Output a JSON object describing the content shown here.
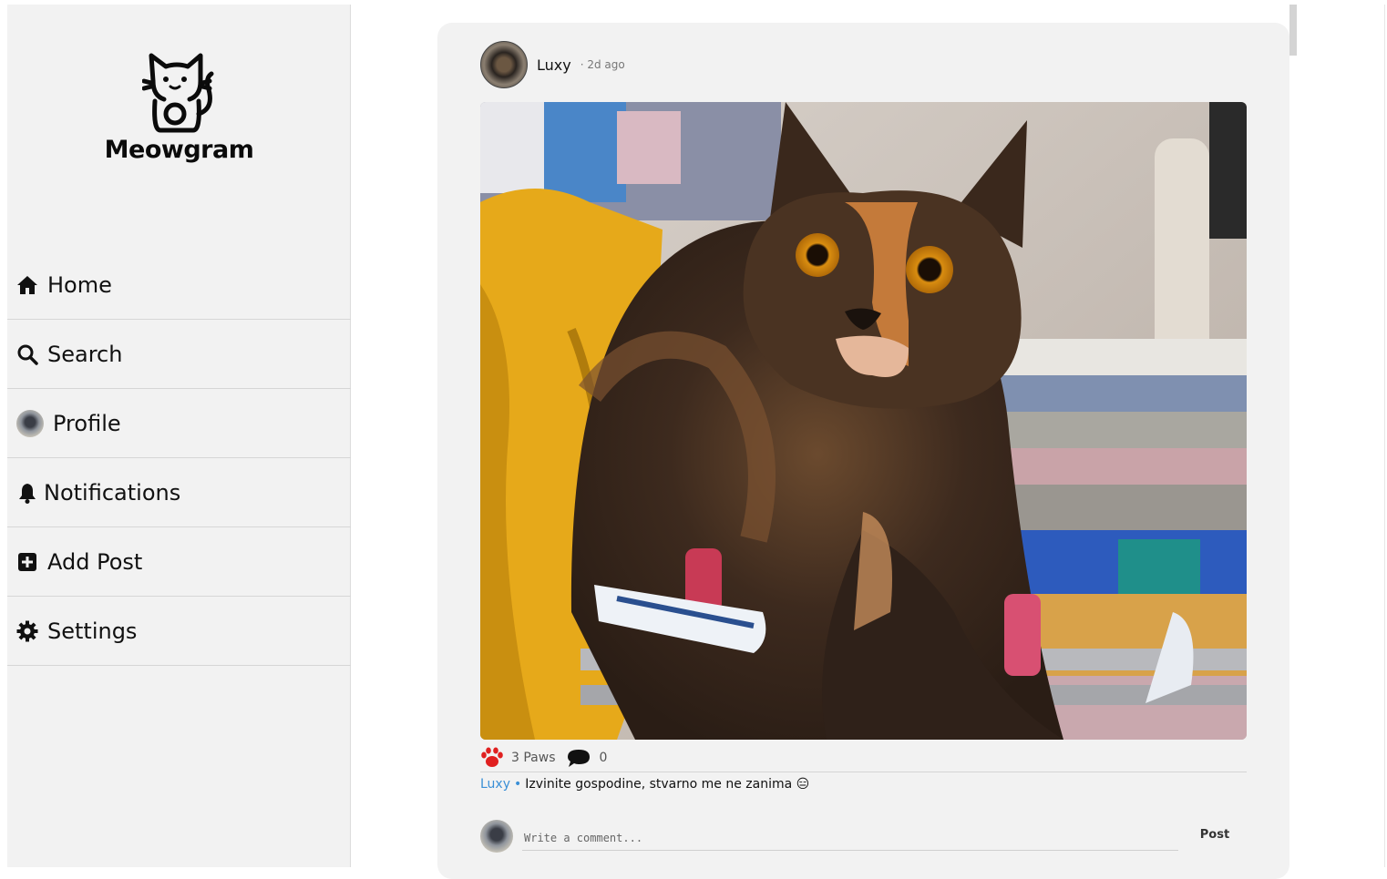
{
  "app": {
    "name": "Meowgram"
  },
  "sidebar": {
    "items": [
      {
        "label": "Home",
        "icon": "home-icon"
      },
      {
        "label": "Search",
        "icon": "search-icon"
      },
      {
        "label": "Profile",
        "icon": "avatar"
      },
      {
        "label": "Notifications",
        "icon": "bell-icon"
      },
      {
        "label": "Add Post",
        "icon": "plus-square-icon"
      },
      {
        "label": "Settings",
        "icon": "gear-icon"
      }
    ]
  },
  "post": {
    "username": "Luxy",
    "time": "· 2d ago",
    "image_alt": "Tortoiseshell cat lying on a drying rack",
    "paws": "3 Paws",
    "comments_count": "0",
    "caption": {
      "user": "Luxy",
      "separator": "•",
      "text": "Izvinite gospodine, stvarno me ne zanima 😑"
    }
  },
  "comment_box": {
    "placeholder": "Write a comment...",
    "post_label": "Post"
  },
  "colors": {
    "sidebar_bg": "#f2f2f2",
    "card_bg": "#f2f2f2",
    "link_blue": "#3a8fd6",
    "paw_red": "#e02020"
  }
}
